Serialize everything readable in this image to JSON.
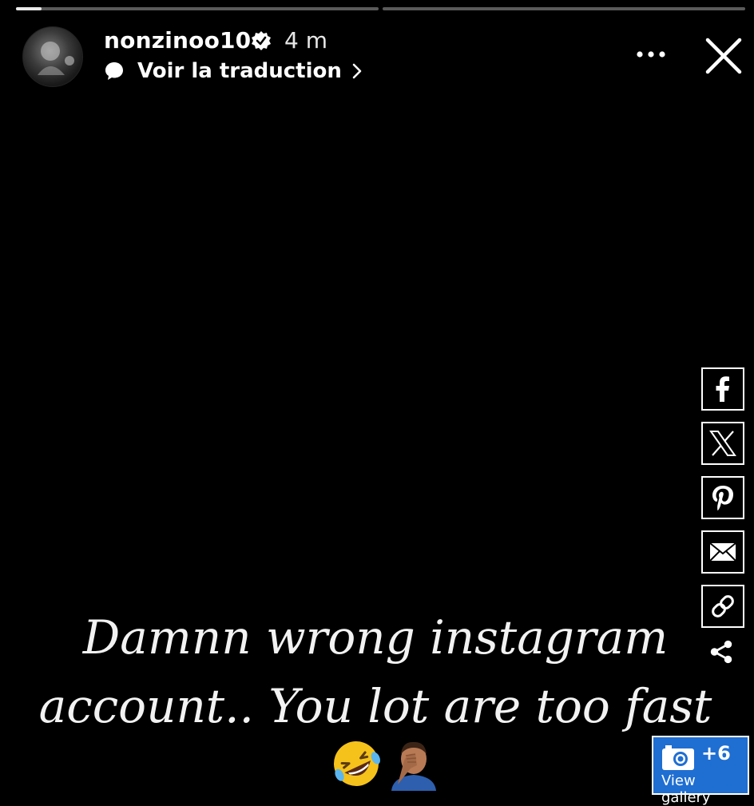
{
  "story": {
    "progress": [
      0.07,
      0.0
    ],
    "username": "nonzinoo10",
    "verified": true,
    "time_ago": "4 m",
    "translate_label": "Voir la traduction",
    "caption_line1": "Damnn wrong instagram",
    "caption_line2": "account.. You lot are too fast",
    "emojis": [
      "rolling-on-floor-laughing",
      "person-facepalming"
    ]
  },
  "icons": {
    "more": "more-options-icon",
    "close": "close-icon"
  },
  "share_bar": {
    "buttons": [
      "facebook",
      "x",
      "pinterest",
      "email",
      "copy-link"
    ],
    "more": "share-icon"
  },
  "gallery": {
    "count": "+6",
    "label": "View gallery",
    "color": "#1f6ed2"
  }
}
